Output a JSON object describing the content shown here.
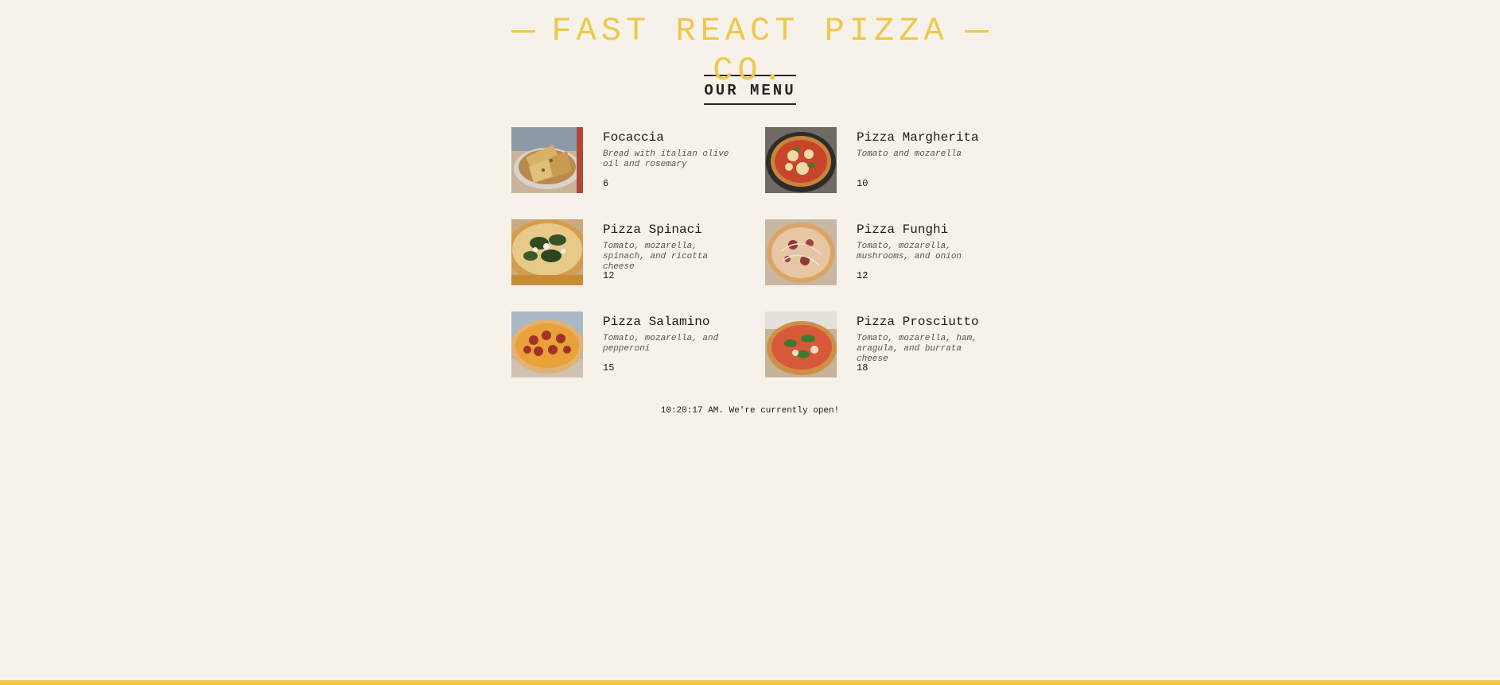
{
  "header": {
    "title": "FAST REACT PIZZA CO."
  },
  "menu": {
    "heading": "OUR MENU",
    "pizzas": [
      {
        "name": "Focaccia",
        "ingredients": "Bread with italian olive oil and rosemary",
        "price": "6",
        "image_icon": "focaccia-photo"
      },
      {
        "name": "Pizza Margherita",
        "ingredients": "Tomato and mozarella",
        "price": "10",
        "image_icon": "pizza-margherita-photo"
      },
      {
        "name": "Pizza Spinaci",
        "ingredients": "Tomato, mozarella, spinach, and ricotta cheese",
        "price": "12",
        "image_icon": "pizza-spinaci-photo"
      },
      {
        "name": "Pizza Funghi",
        "ingredients": "Tomato, mozarella, mushrooms, and onion",
        "price": "12",
        "image_icon": "pizza-funghi-photo"
      },
      {
        "name": "Pizza Salamino",
        "ingredients": "Tomato, mozarella, and pepperoni",
        "price": "15",
        "image_icon": "pizza-salamino-photo"
      },
      {
        "name": "Pizza Prosciutto",
        "ingredients": "Tomato, mozarella, ham, aragula, and burrata cheese",
        "price": "18",
        "image_icon": "pizza-prosciutto-photo"
      }
    ]
  },
  "footer": {
    "status": "10:20:17 AM. We're currently open!"
  },
  "colors": {
    "background": "#f7f2e9",
    "accent": "#edc84b",
    "text": "#252525"
  }
}
